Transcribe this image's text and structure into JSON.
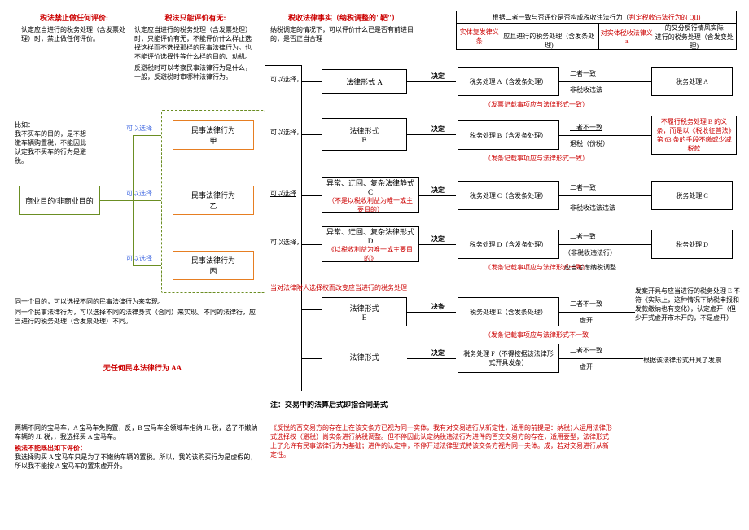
{
  "left": {
    "header1_title": "税法禁止做任何评价:",
    "header1_body": "认定应当进行的税务处理（含发票处理）时，禁止做任何评价。",
    "header2_title": "税法只能评价有无:",
    "header2_body1": "认定应当进行的税务处理（含发票处理）时，只能评价有无，不能评价什么样止选择这样而不选择那样的民事法律行为。也不能评价选择性等什么样的目的、动机。",
    "header2_body2": "反避税时可以考察民事法律行为是什么，一般，反避税时审哪种法律行为。",
    "example_label": "比如：",
    "example_body": "我不买车的目的，是不想缴车辆购置税，不能因此认定我不买车的行为是避税。",
    "box_purpose": "商业目的/非商业目的",
    "choose_label": "可以选择",
    "box_a": "民事法律行为\n甲",
    "box_b": "民事法律行为\n乙",
    "box_c": "民事法律行为\n丙",
    "note1": "同一个目的，可以选择不同的民事法律行为来实现。",
    "note2": "同一个民事法律行为，可以选择不同的法律身式（合同）来实现。不同的法律行，应当进行的税务处理（含发票处理）不同。",
    "noform_title": "无任何民本法律行为 AA",
    "bmw_body1": "两辆不同的宝马车，A 宝马车免购置，反，B 宝马车全领域车指纳 JL 税，选了不嫩纳车辆的 JL 税，，我选择买 A 宝马车。",
    "bmw_title": "税法不能既出如下评价：",
    "bmw_body2": "我选择购买 A 宝马车只是为了不嫩纳车辆的置税。所以，我的该购买行为是虚假的，所以我不能按 A 宝马车的置来虚开外。"
  },
  "mid": {
    "header_title": "税收法律事实（纳税调整的\"靶\"）",
    "header_body": "纳税调定的情况下，可以评价什么已是否有前进目的，是否正当合理",
    "choose_label": "可以选择，",
    "choose_label2": "可以选择",
    "form_a": "法律形式 A",
    "form_b": "法律形式\nB",
    "form_c_title": "异常、迂回、复杂法律静式 C",
    "form_c_sub": "（不是以税收利益为唯一或主要目的）",
    "form_d_title": "异常、迂回、复杂法律形式 D",
    "form_d_sub": "《以税收利益为唯一或主要目的》",
    "form_e": "法律形式\nE",
    "form_f": "法律形式",
    "decide": "决定",
    "decide2": "决条",
    "red_line_note": "当对法律附人选择权而改变应当进行的税务处理",
    "footer_title": "注：交易中的法算后式即指合同册式",
    "footer_body": "《反悦的否交易方的存在上在该交条方已视为同一实体，我有对交易进行从新定性，适用的前提是：纳税}人运用法律形式选择权（避税）尚实条进行纳税调整。但不停因此认定纳税违法行为进件的否交交易方的存在，适用要型，法律形式上了允许有民事法律行为为基础；进件的认定中，不停开过法律型式特该交条方视为同一夫体。成，若对交易进行从新定性。"
  },
  "right": {
    "top_line1": "根据二者一致与否评价是否构成税收违法行为（",
    "top_line1_red": "判定税收违法行为的 QII)",
    "top_col1": "<span class='txt-red'>实体复发律义条</span><br>应且进行的税务处理（含发条处理)",
    "top_col2": "<span class='txt-red'>对实体税收法律义 a</span> 的又分反行情风实际<br>进行的税务处理（含发变处理)",
    "row_a": {
      "tax": "税务处理 A（含发条处理）",
      "mid1": "二者一致",
      "mid2": "非税收违法",
      "mid3_red": "（发票记载事项应与法律形式一致）",
      "right": "税务处理 A"
    },
    "row_b": {
      "tax": "税务处理 B（含发条处理）",
      "mid1": "二者不一致",
      "mid2": "退税（份税）",
      "mid3_red": "（发条记载事项应与法律形式一致）",
      "right": "不履行税务处理 B 的义条，而是以《税收征营法》第 63 条的手段不缴或少减税款"
    },
    "row_c": {
      "tax": "税务处理 C（含发条处理）",
      "mid1": "二者一致",
      "mid2": "非税收违法违法",
      "right": "税务处理 C"
    },
    "row_d": {
      "tax": "税务处理 D（含发条处理）",
      "mid1": "二者一致",
      "mid2": "（非税收违法行）",
      "mid3": "应当考虑纳税调整",
      "mid4_red": "（发条记载事项应与法律形式一致）",
      "right": "税务处理 D"
    },
    "row_e": {
      "tax": "税务处理 E（含发条处理）",
      "mid1": "二者不一致",
      "mid2": "虚开",
      "mid3_red": "（发条记载事项应与法律形式不一致",
      "right": "发案开具与应当进行的税务处理 E 不符《实际上，这种情况下纳税申报和发款缴纳也有变化），认定虚开（但少开式虚开市木开的，不是虚开）"
    },
    "row_f": {
      "tax": "税务处理 F（不得按据该法律形式开具发条）",
      "mid1": "二者不一致",
      "mid2": "虚开",
      "right": "根据该法律形式开具了发票"
    }
  }
}
